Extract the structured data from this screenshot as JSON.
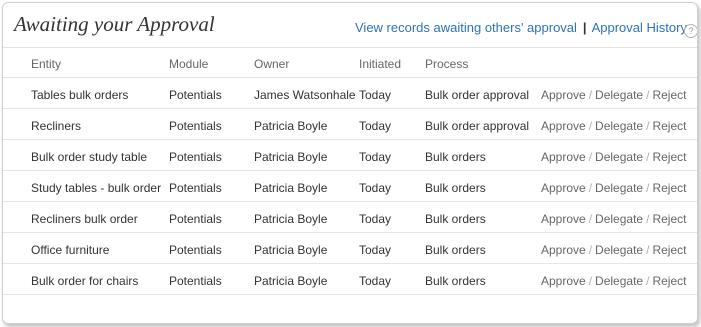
{
  "header": {
    "title": "Awaiting your Approval",
    "link_others": "View records awaiting others' approval",
    "separator": "|",
    "link_history": "Approval History",
    "help_glyph": "?"
  },
  "columns": {
    "entity": "Entity",
    "module": "Module",
    "owner": "Owner",
    "initiated": "Initiated",
    "process": "Process"
  },
  "actions": {
    "approve": "Approve",
    "delegate": "Delegate",
    "reject": "Reject",
    "separator": "/"
  },
  "rows": [
    {
      "entity": "Tables bulk orders",
      "module": "Potentials",
      "owner": "James Watsonhale",
      "initiated": "Today",
      "process": "Bulk order approval"
    },
    {
      "entity": "Recliners",
      "module": "Potentials",
      "owner": "Patricia Boyle",
      "initiated": "Today",
      "process": "Bulk order approval"
    },
    {
      "entity": "Bulk order study table",
      "module": "Potentials",
      "owner": "Patricia Boyle",
      "initiated": "Today",
      "process": "Bulk orders"
    },
    {
      "entity": "Study tables - bulk order",
      "module": "Potentials",
      "owner": "Patricia Boyle",
      "initiated": "Today",
      "process": "Bulk orders"
    },
    {
      "entity": "Recliners bulk order",
      "module": "Potentials",
      "owner": "Patricia Boyle",
      "initiated": "Today",
      "process": "Bulk orders"
    },
    {
      "entity": "Office furniture",
      "module": "Potentials",
      "owner": "Patricia Boyle",
      "initiated": "Today",
      "process": "Bulk orders"
    },
    {
      "entity": "Bulk order for chairs",
      "module": "Potentials",
      "owner": "Patricia Boyle",
      "initiated": "Today",
      "process": "Bulk orders"
    }
  ],
  "colors": {
    "link": "#2d73b8",
    "text": "#333333",
    "muted": "#666666"
  }
}
